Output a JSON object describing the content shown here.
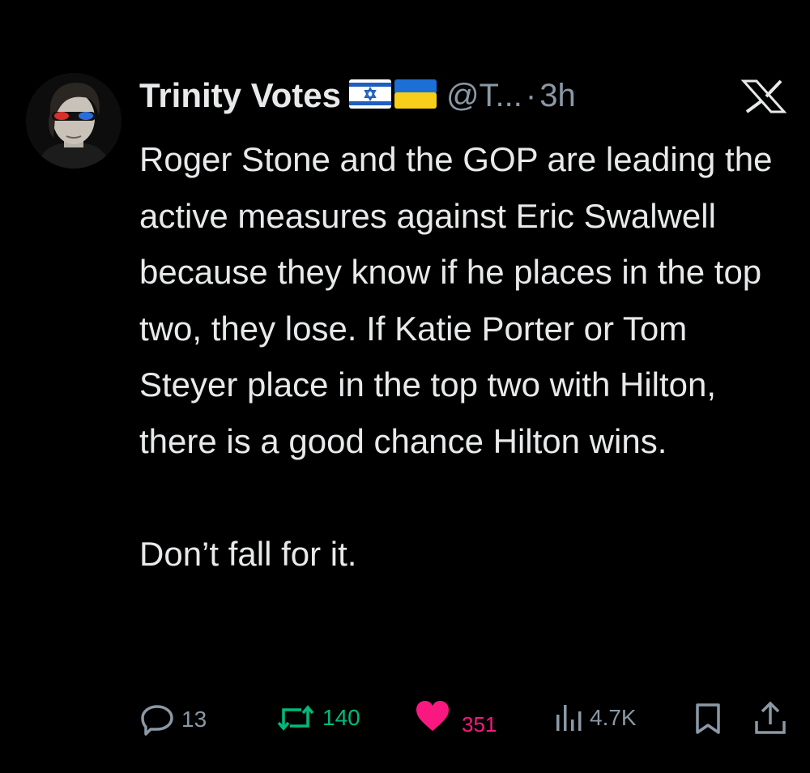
{
  "tweet": {
    "author": {
      "display_name": "Trinity Votes",
      "flags": [
        "israel-flag",
        "ukraine-flag"
      ],
      "handle": "@T...",
      "separator": "·",
      "time": "3h"
    },
    "platform_icon": "x-logo-icon",
    "text_paragraphs": [
      "Roger Stone and the GOP are leading the active measures against Eric Swalwell because they know if he places in the top two, they lose. If Katie Porter or Tom Steyer place in the top two with Hilton, there is a good chance Hilton wins.",
      "Don’t fall for it."
    ],
    "actions": {
      "replies": "13",
      "retweets": "140",
      "likes": "351",
      "views": "4.7K"
    },
    "colors": {
      "background": "#000000",
      "text": "#e7e9ea",
      "secondary": "#8b98a5",
      "retweet": "#00ba7c",
      "like": "#f91880"
    }
  }
}
